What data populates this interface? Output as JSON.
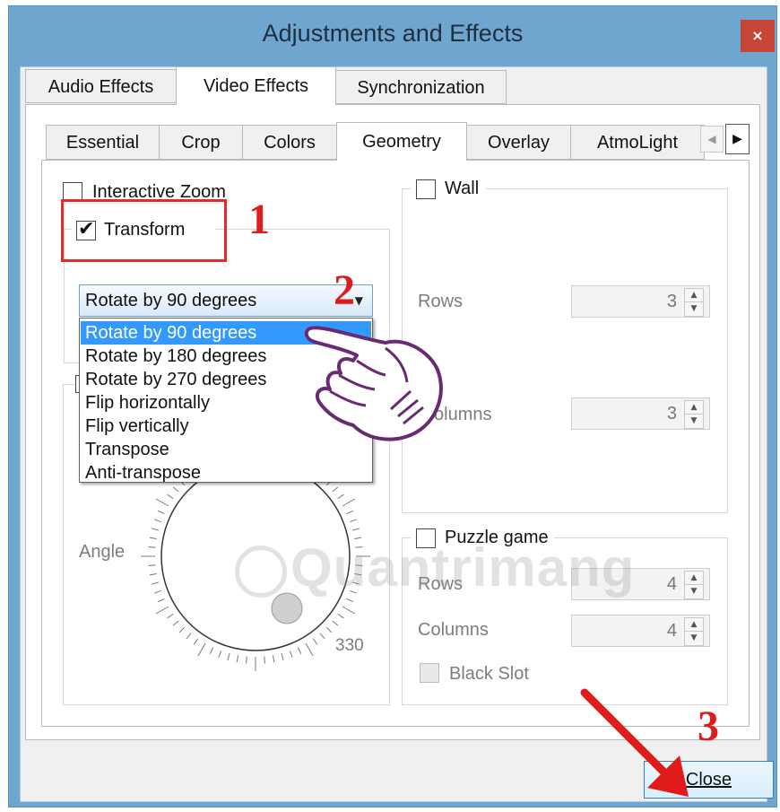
{
  "window": {
    "title": "Adjustments and Effects",
    "close_glyph": "×"
  },
  "main_tabs": [
    {
      "label": "Audio Effects"
    },
    {
      "label": "Video Effects"
    },
    {
      "label": "Synchronization"
    }
  ],
  "sub_tabs": [
    {
      "label": "Essential"
    },
    {
      "label": "Crop"
    },
    {
      "label": "Colors"
    },
    {
      "label": "Geometry"
    },
    {
      "label": "Overlay"
    },
    {
      "label": "AtmoLight"
    }
  ],
  "geometry": {
    "interactive_zoom_label": "Interactive Zoom",
    "transform_label": "Transform",
    "transform_select_value": "Rotate by 90 degrees",
    "transform_options": [
      "Rotate by 90 degrees",
      "Rotate by 180 degrees",
      "Rotate by 270 degrees",
      "Flip horizontally",
      "Flip vertically",
      "Transpose",
      "Anti-transpose"
    ],
    "angle_label": "Angle",
    "angle_value": "330",
    "wall_label": "Wall",
    "wall_rows_label": "Rows",
    "wall_rows_value": "3",
    "wall_columns_label": "olumns",
    "wall_columns_value": "3",
    "puzzle_label": "Puzzle game",
    "puzzle_rows_label": "Rows",
    "puzzle_rows_value": "4",
    "puzzle_columns_label": "Columns",
    "puzzle_columns_value": "4",
    "black_slot_label": "Black Slot"
  },
  "buttons": {
    "close_label": "Close"
  },
  "annotations": {
    "step1": "1",
    "step2": "2",
    "step3": "3"
  },
  "watermark": "Quantrimang",
  "colors": {
    "titlebar": "#6fa6cf",
    "highlight": "#3399ff",
    "annotation_red": "#e01b1b",
    "close_red": "#c74536"
  }
}
